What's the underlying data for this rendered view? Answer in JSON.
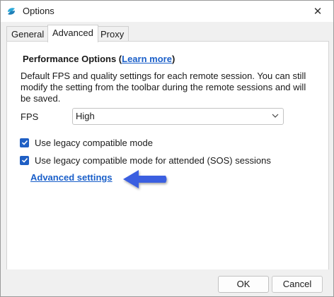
{
  "window": {
    "title": "Options",
    "close_glyph": "✕"
  },
  "tabs": [
    {
      "label": "General",
      "active": false
    },
    {
      "label": "Advanced",
      "active": true
    },
    {
      "label": "Proxy",
      "active": false
    }
  ],
  "performance": {
    "heading": "Performance Options (",
    "link": "Learn more",
    "heading_end": ")",
    "description": "Default FPS and quality settings for each remote session. You can still modify the setting from the toolbar during the remote sessions and will be saved.",
    "fps_label": "FPS",
    "fps_value": "High"
  },
  "options": [
    {
      "label": "Use legacy compatible mode",
      "checked": true
    },
    {
      "label": "Use legacy compatible mode for attended (SOS) sessions",
      "checked": true
    }
  ],
  "advanced_link": "Advanced settings",
  "buttons": {
    "ok": "OK",
    "cancel": "Cancel"
  },
  "colors": {
    "accent": "#1f5fc4",
    "link": "#1a5fc9",
    "arrow": "#3b5fe0"
  },
  "icons": {
    "app": "app-logo-icon",
    "arrow": "pointer-arrow-icon"
  }
}
